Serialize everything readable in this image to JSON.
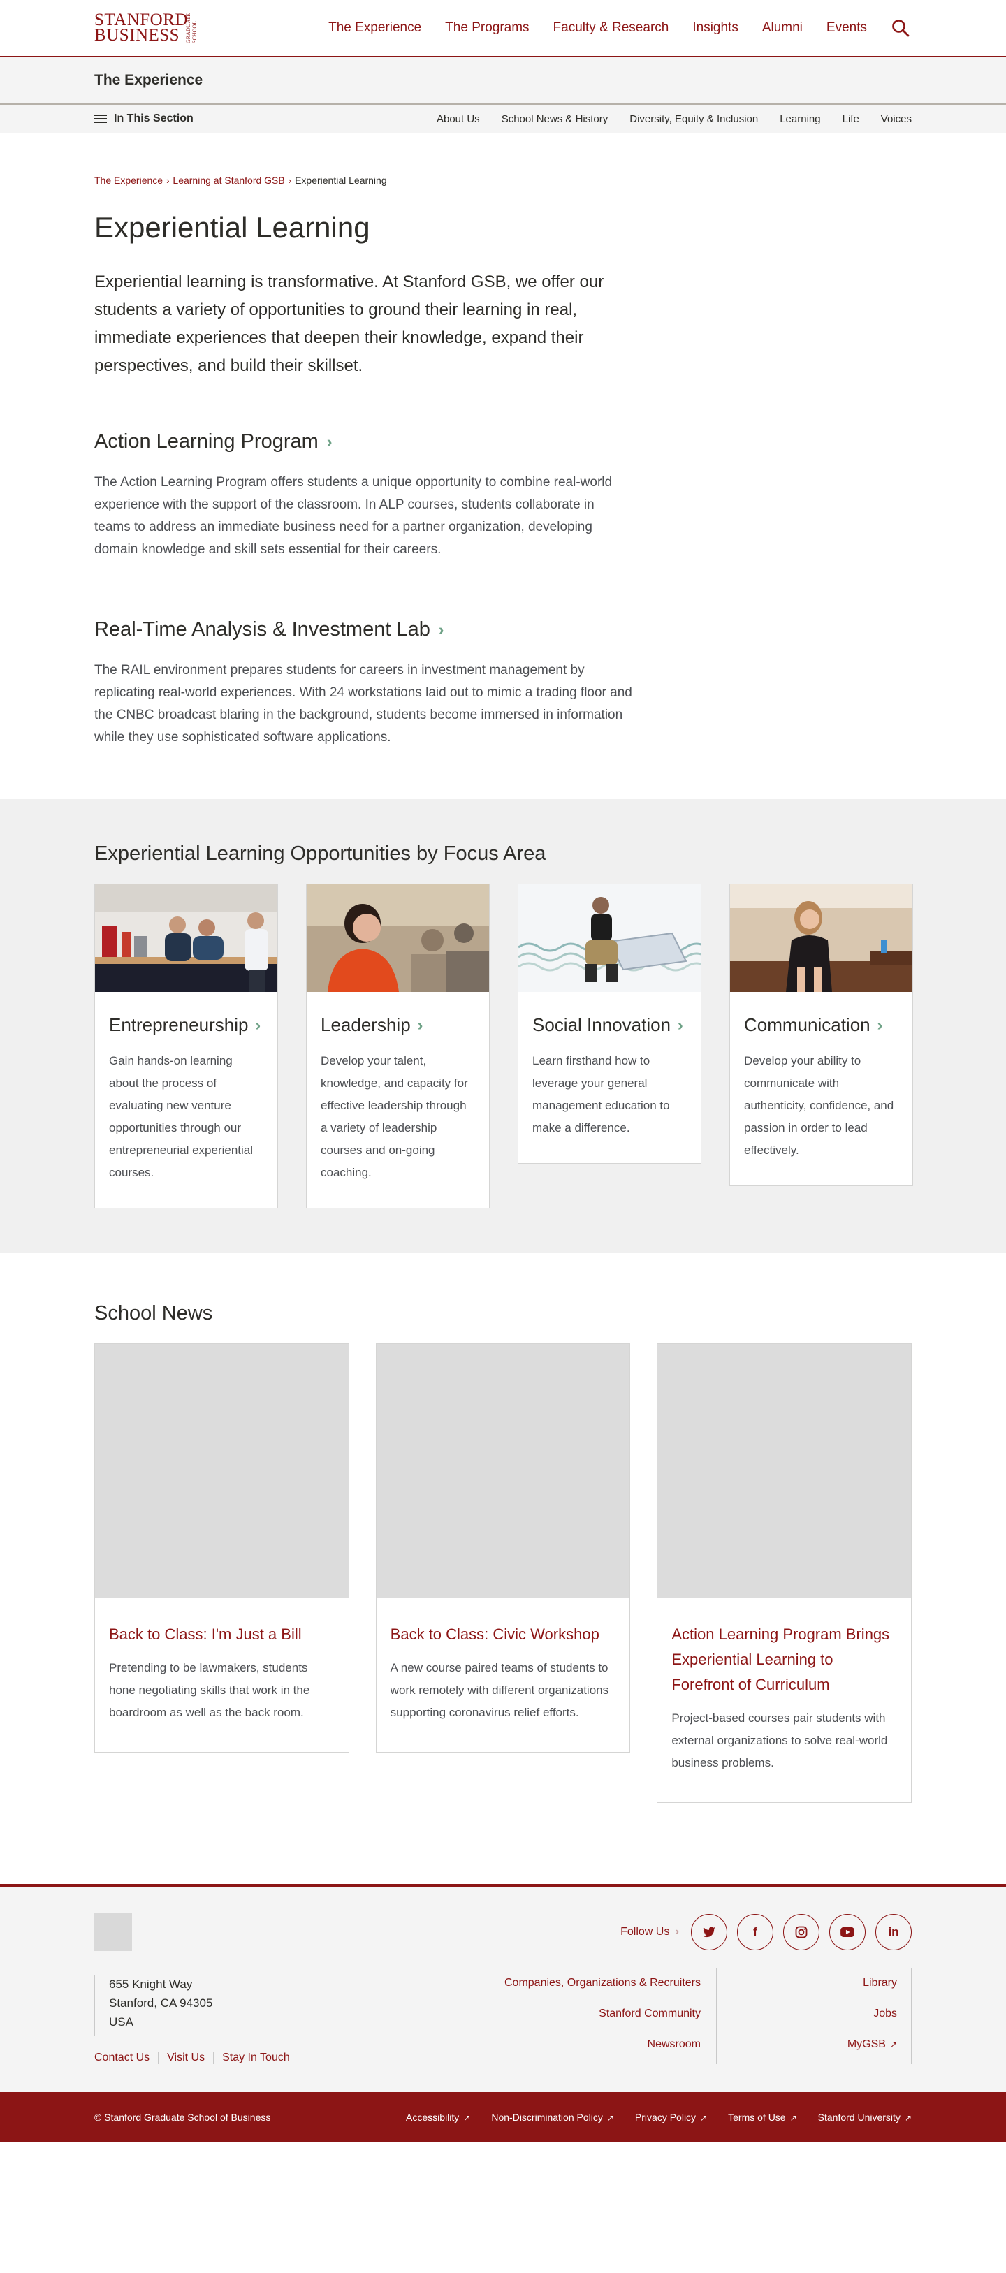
{
  "header": {
    "logo_main": "STANFORD BUSINESS",
    "logo_sub": "GRADUATE SCHOOL",
    "nav": [
      "The Experience",
      "The Programs",
      "Faculty & Research",
      "Insights",
      "Alumni",
      "Events"
    ]
  },
  "section": {
    "title": "The Experience",
    "in_section_label": "In This Section",
    "links": [
      "About Us",
      "School News & History",
      "Diversity, Equity & Inclusion",
      "Learning",
      "Life",
      "Voices"
    ]
  },
  "breadcrumb": {
    "items": [
      "The Experience",
      "Learning at Stanford GSB"
    ],
    "current": "Experiential Learning"
  },
  "main": {
    "title": "Experiential Learning",
    "intro": "Experiential learning is transformative. At Stanford GSB, we offer our students a variety of opportunities to ground their learning in real, immediate experiences that deepen their knowledge, expand their perspectives, and build their skillset.",
    "features": [
      {
        "title": "Action Learning Program",
        "text": "The Action Learning Program offers students a unique opportunity to combine real-world experience with the support of the classroom. In ALP courses, students collaborate in teams to address an immediate business need for a partner organization, developing domain knowledge and skill sets essential for their careers."
      },
      {
        "title": "Real-Time Analysis & Investment Lab",
        "text": "The RAIL environment prepares students for careers in investment management by replicating real-world experiences. With 24 workstations laid out to mimic a trading floor and the CNBC broadcast blaring in the background, students become immersed in information while they use sophisticated software applications."
      }
    ]
  },
  "focus": {
    "title": "Experiential Learning Opportunities by Focus Area",
    "cards": [
      {
        "title": "Entrepreneurship",
        "text": "Gain hands-on learning about the process of evaluating new venture opportunities through our entrepreneurial experiential courses."
      },
      {
        "title": "Leadership",
        "text": "Develop your talent, knowledge, and capacity for effective leadership through a variety of leadership courses and on-going coaching."
      },
      {
        "title": "Social Innovation",
        "text": "Learn firsthand how to leverage your general management education to make a difference."
      },
      {
        "title": "Communication",
        "text": "Develop your ability to communicate with authenticity, confidence, and passion in order to lead effectively."
      }
    ]
  },
  "news": {
    "title": "School News",
    "cards": [
      {
        "title": "Back to Class: I'm Just a Bill",
        "text": "Pretending to be lawmakers, students hone negotiating skills that work in the boardroom as well as the back room."
      },
      {
        "title": "Back to Class: Civic Workshop",
        "text": "A new course paired teams of students to work remotely with different organizations supporting coronavirus relief efforts."
      },
      {
        "title": "Action Learning Program Brings Experiential Learning to Forefront of Curriculum",
        "text": "Project-based courses pair students with external organizations to solve real-world business problems."
      }
    ]
  },
  "footer": {
    "follow_label": "Follow Us",
    "social": [
      {
        "icon": "twitter-icon",
        "glyph": "t"
      },
      {
        "icon": "facebook-icon",
        "glyph": "f"
      },
      {
        "icon": "instagram-icon",
        "glyph": "◎"
      },
      {
        "icon": "youtube-icon",
        "glyph": "▶"
      },
      {
        "icon": "linkedin-icon",
        "glyph": "in"
      }
    ],
    "address": [
      "655 Knight Way",
      "Stanford, CA 94305",
      "USA"
    ],
    "links_left": [
      "Companies, Organizations & Recruiters",
      "Stanford Community",
      "Newsroom"
    ],
    "links_right": [
      "Library",
      "Jobs",
      "MyGSB"
    ],
    "bottom_links": [
      "Contact Us",
      "Visit Us",
      "Stay In Touch"
    ]
  },
  "legal": {
    "copyright": "© Stanford Graduate School of Business",
    "links": [
      "Accessibility",
      "Non-Discrimination Policy",
      "Privacy Policy",
      "Terms of Use",
      "Stanford University"
    ]
  },
  "colors": {
    "brand": "#8c1515",
    "accent_chevron": "#6fa287",
    "light_bg": "#f0f0f0"
  }
}
